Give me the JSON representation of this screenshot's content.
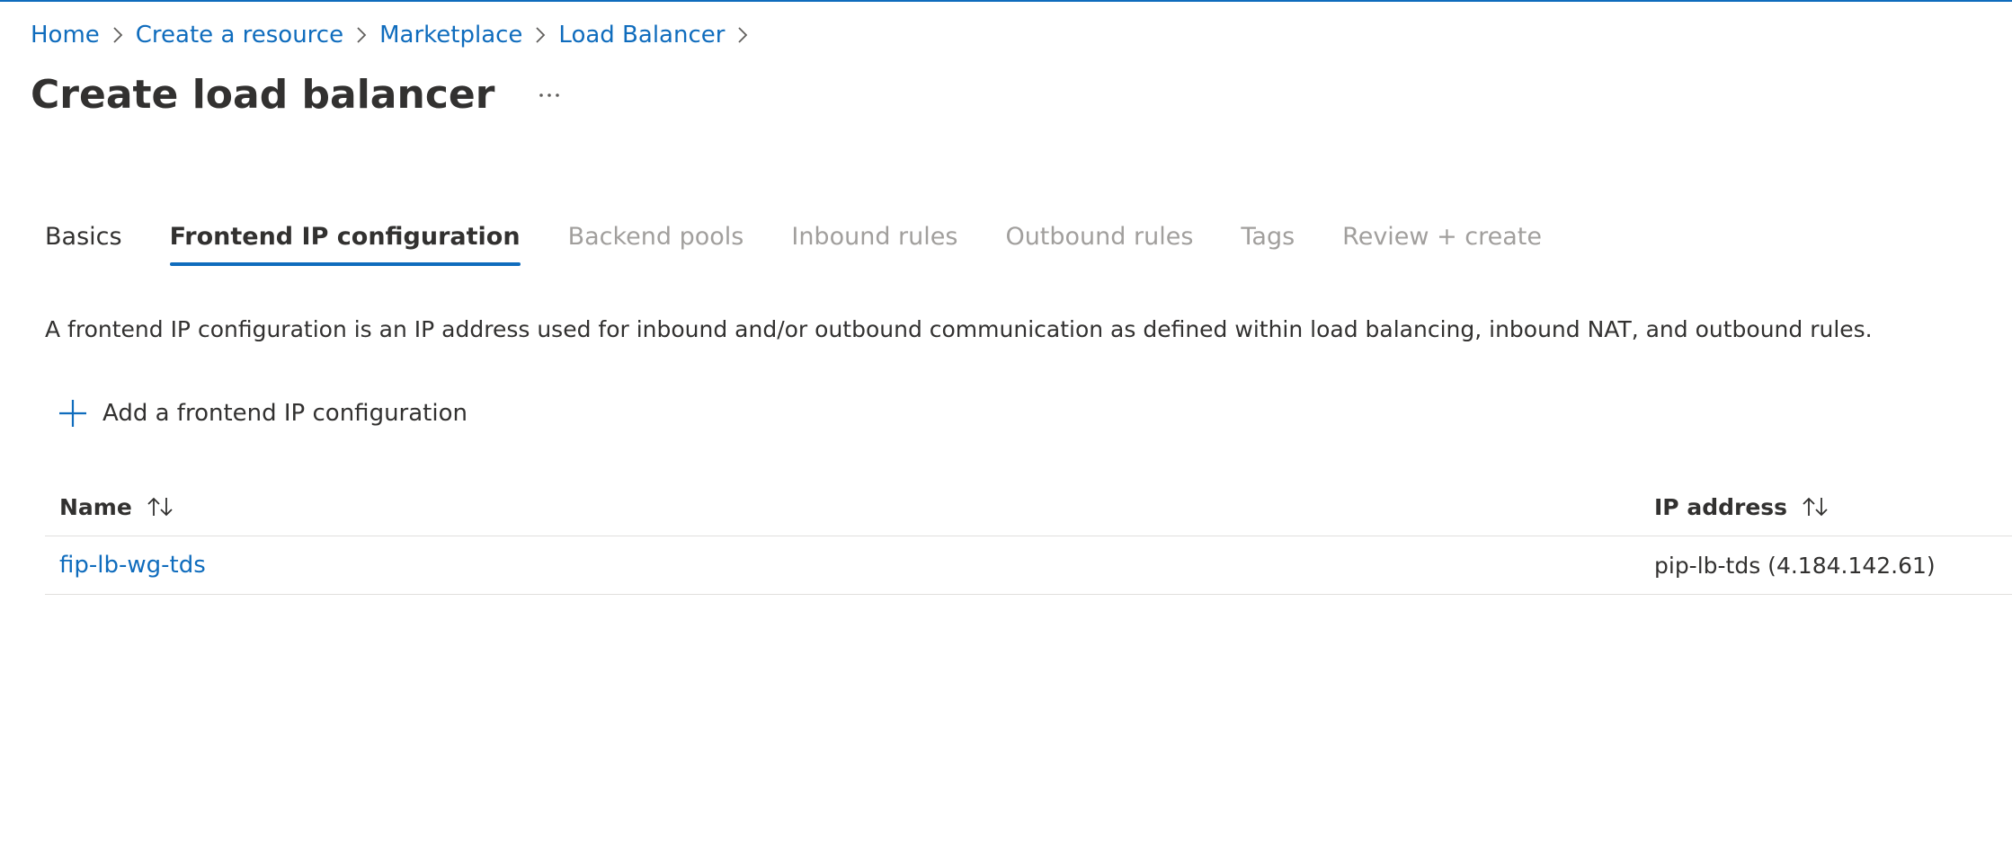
{
  "breadcrumb": [
    {
      "label": "Home"
    },
    {
      "label": "Create a resource"
    },
    {
      "label": "Marketplace"
    },
    {
      "label": "Load Balancer"
    }
  ],
  "page": {
    "title": "Create load balancer",
    "more_icon": "ellipsis-icon"
  },
  "tabs": [
    {
      "label": "Basics",
      "state": "done"
    },
    {
      "label": "Frontend IP configuration",
      "state": "active"
    },
    {
      "label": "Backend pools",
      "state": "disabled"
    },
    {
      "label": "Inbound rules",
      "state": "disabled"
    },
    {
      "label": "Outbound rules",
      "state": "disabled"
    },
    {
      "label": "Tags",
      "state": "disabled"
    },
    {
      "label": "Review + create",
      "state": "disabled"
    }
  ],
  "description": "A frontend IP configuration is an IP address used for inbound and/or outbound communication as defined within load balancing, inbound NAT, and outbound rules.",
  "add_button": {
    "label": "Add a frontend IP configuration",
    "icon": "plus-icon"
  },
  "table": {
    "columns": [
      {
        "label": "Name",
        "sort_icon": "sort-arrows-icon"
      },
      {
        "label": "IP address",
        "sort_icon": "sort-arrows-icon"
      }
    ],
    "rows": [
      {
        "name": "fip-lb-wg-tds",
        "ip_address": "pip-lb-tds (4.184.142.61)"
      }
    ]
  },
  "colors": {
    "accent": "#0f6cbd",
    "text": "#323130",
    "disabled": "#a19f9d",
    "divider": "#e1dfdd"
  }
}
